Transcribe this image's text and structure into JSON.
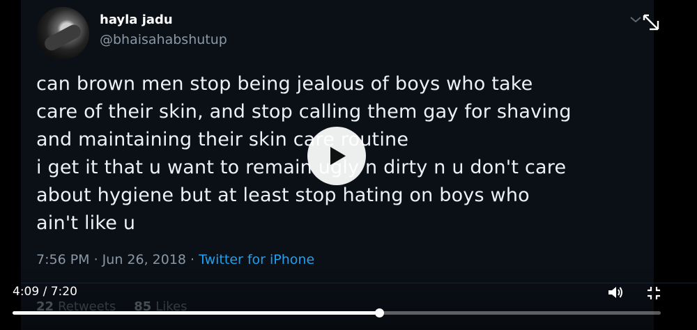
{
  "tweet": {
    "display_name": "hayla jadu",
    "handle": "@bhaisahabshutup",
    "text_lines": [
      "can brown men stop being jealous of boys who take",
      "care of their skin, and stop calling them gay for shaving",
      "and maintaining their skin care routine",
      "i get it that u want to remain ugly n dirty n u don't care",
      "about hygiene but at least stop hating on boys who",
      "ain't like u"
    ],
    "timestamp": "7:56 PM · Jun 26, 2018 · ",
    "source": "Twitter for iPhone",
    "retweets_count": "22",
    "retweets_label": "Retweets",
    "likes_count": "85",
    "likes_label": "Likes"
  },
  "player": {
    "time_display": "4:09 / 7:20",
    "progress_fraction": 0.566,
    "icons": {
      "play": "play-icon",
      "volume": "volume-icon",
      "exit_fullscreen": "exit-fullscreen-icon",
      "pip": "picture-in-picture-off-icon",
      "caret": "chevron-down-icon"
    }
  },
  "colors": {
    "video_background": "#0b1017",
    "link_blue": "#1da1f2",
    "muted_text": "#8b98a5"
  }
}
